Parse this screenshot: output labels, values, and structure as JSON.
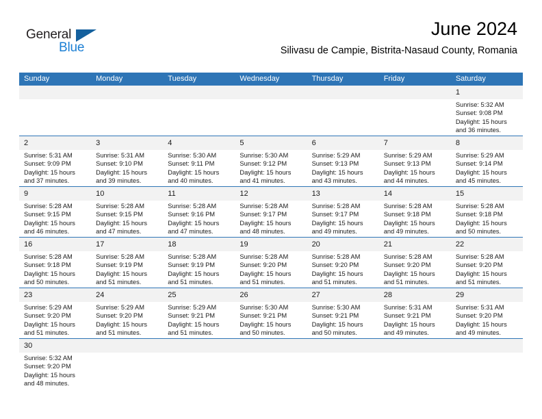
{
  "brand": {
    "name_top": "General",
    "name_bottom": "Blue",
    "flag_icon": "triangle-flag-icon",
    "color_dark": "#231f20",
    "color_blue": "#1b7fd4",
    "color_flag": "#15619e"
  },
  "header": {
    "month_title": "June 2024",
    "location": "Silivasu de Campie, Bistrita-Nasaud County, Romania"
  },
  "calendar": {
    "accent_color": "#2e75b6",
    "number_band_color": "#f2f2f2",
    "day_headers": [
      "Sunday",
      "Monday",
      "Tuesday",
      "Wednesday",
      "Thursday",
      "Friday",
      "Saturday"
    ],
    "weeks": [
      [
        {
          "day": "",
          "lines": []
        },
        {
          "day": "",
          "lines": []
        },
        {
          "day": "",
          "lines": []
        },
        {
          "day": "",
          "lines": []
        },
        {
          "day": "",
          "lines": []
        },
        {
          "day": "",
          "lines": []
        },
        {
          "day": "1",
          "lines": [
            "Sunrise: 5:32 AM",
            "Sunset: 9:08 PM",
            "Daylight: 15 hours",
            "and 36 minutes."
          ]
        }
      ],
      [
        {
          "day": "2",
          "lines": [
            "Sunrise: 5:31 AM",
            "Sunset: 9:09 PM",
            "Daylight: 15 hours",
            "and 37 minutes."
          ]
        },
        {
          "day": "3",
          "lines": [
            "Sunrise: 5:31 AM",
            "Sunset: 9:10 PM",
            "Daylight: 15 hours",
            "and 39 minutes."
          ]
        },
        {
          "day": "4",
          "lines": [
            "Sunrise: 5:30 AM",
            "Sunset: 9:11 PM",
            "Daylight: 15 hours",
            "and 40 minutes."
          ]
        },
        {
          "day": "5",
          "lines": [
            "Sunrise: 5:30 AM",
            "Sunset: 9:12 PM",
            "Daylight: 15 hours",
            "and 41 minutes."
          ]
        },
        {
          "day": "6",
          "lines": [
            "Sunrise: 5:29 AM",
            "Sunset: 9:13 PM",
            "Daylight: 15 hours",
            "and 43 minutes."
          ]
        },
        {
          "day": "7",
          "lines": [
            "Sunrise: 5:29 AM",
            "Sunset: 9:13 PM",
            "Daylight: 15 hours",
            "and 44 minutes."
          ]
        },
        {
          "day": "8",
          "lines": [
            "Sunrise: 5:29 AM",
            "Sunset: 9:14 PM",
            "Daylight: 15 hours",
            "and 45 minutes."
          ]
        }
      ],
      [
        {
          "day": "9",
          "lines": [
            "Sunrise: 5:28 AM",
            "Sunset: 9:15 PM",
            "Daylight: 15 hours",
            "and 46 minutes."
          ]
        },
        {
          "day": "10",
          "lines": [
            "Sunrise: 5:28 AM",
            "Sunset: 9:15 PM",
            "Daylight: 15 hours",
            "and 47 minutes."
          ]
        },
        {
          "day": "11",
          "lines": [
            "Sunrise: 5:28 AM",
            "Sunset: 9:16 PM",
            "Daylight: 15 hours",
            "and 47 minutes."
          ]
        },
        {
          "day": "12",
          "lines": [
            "Sunrise: 5:28 AM",
            "Sunset: 9:17 PM",
            "Daylight: 15 hours",
            "and 48 minutes."
          ]
        },
        {
          "day": "13",
          "lines": [
            "Sunrise: 5:28 AM",
            "Sunset: 9:17 PM",
            "Daylight: 15 hours",
            "and 49 minutes."
          ]
        },
        {
          "day": "14",
          "lines": [
            "Sunrise: 5:28 AM",
            "Sunset: 9:18 PM",
            "Daylight: 15 hours",
            "and 49 minutes."
          ]
        },
        {
          "day": "15",
          "lines": [
            "Sunrise: 5:28 AM",
            "Sunset: 9:18 PM",
            "Daylight: 15 hours",
            "and 50 minutes."
          ]
        }
      ],
      [
        {
          "day": "16",
          "lines": [
            "Sunrise: 5:28 AM",
            "Sunset: 9:18 PM",
            "Daylight: 15 hours",
            "and 50 minutes."
          ]
        },
        {
          "day": "17",
          "lines": [
            "Sunrise: 5:28 AM",
            "Sunset: 9:19 PM",
            "Daylight: 15 hours",
            "and 51 minutes."
          ]
        },
        {
          "day": "18",
          "lines": [
            "Sunrise: 5:28 AM",
            "Sunset: 9:19 PM",
            "Daylight: 15 hours",
            "and 51 minutes."
          ]
        },
        {
          "day": "19",
          "lines": [
            "Sunrise: 5:28 AM",
            "Sunset: 9:20 PM",
            "Daylight: 15 hours",
            "and 51 minutes."
          ]
        },
        {
          "day": "20",
          "lines": [
            "Sunrise: 5:28 AM",
            "Sunset: 9:20 PM",
            "Daylight: 15 hours",
            "and 51 minutes."
          ]
        },
        {
          "day": "21",
          "lines": [
            "Sunrise: 5:28 AM",
            "Sunset: 9:20 PM",
            "Daylight: 15 hours",
            "and 51 minutes."
          ]
        },
        {
          "day": "22",
          "lines": [
            "Sunrise: 5:28 AM",
            "Sunset: 9:20 PM",
            "Daylight: 15 hours",
            "and 51 minutes."
          ]
        }
      ],
      [
        {
          "day": "23",
          "lines": [
            "Sunrise: 5:29 AM",
            "Sunset: 9:20 PM",
            "Daylight: 15 hours",
            "and 51 minutes."
          ]
        },
        {
          "day": "24",
          "lines": [
            "Sunrise: 5:29 AM",
            "Sunset: 9:20 PM",
            "Daylight: 15 hours",
            "and 51 minutes."
          ]
        },
        {
          "day": "25",
          "lines": [
            "Sunrise: 5:29 AM",
            "Sunset: 9:21 PM",
            "Daylight: 15 hours",
            "and 51 minutes."
          ]
        },
        {
          "day": "26",
          "lines": [
            "Sunrise: 5:30 AM",
            "Sunset: 9:21 PM",
            "Daylight: 15 hours",
            "and 50 minutes."
          ]
        },
        {
          "day": "27",
          "lines": [
            "Sunrise: 5:30 AM",
            "Sunset: 9:21 PM",
            "Daylight: 15 hours",
            "and 50 minutes."
          ]
        },
        {
          "day": "28",
          "lines": [
            "Sunrise: 5:31 AM",
            "Sunset: 9:21 PM",
            "Daylight: 15 hours",
            "and 49 minutes."
          ]
        },
        {
          "day": "29",
          "lines": [
            "Sunrise: 5:31 AM",
            "Sunset: 9:20 PM",
            "Daylight: 15 hours",
            "and 49 minutes."
          ]
        }
      ],
      [
        {
          "day": "30",
          "lines": [
            "Sunrise: 5:32 AM",
            "Sunset: 9:20 PM",
            "Daylight: 15 hours",
            "and 48 minutes."
          ]
        },
        {
          "day": "",
          "lines": []
        },
        {
          "day": "",
          "lines": []
        },
        {
          "day": "",
          "lines": []
        },
        {
          "day": "",
          "lines": []
        },
        {
          "day": "",
          "lines": []
        },
        {
          "day": "",
          "lines": []
        }
      ]
    ]
  }
}
